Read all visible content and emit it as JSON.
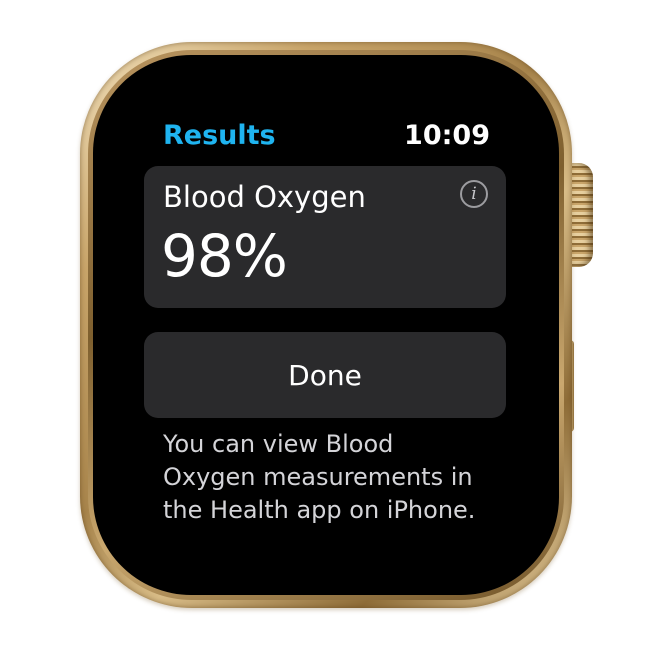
{
  "screen": {
    "header": {
      "title": "Results",
      "time": "10:09"
    },
    "measurement_card": {
      "label": "Blood Oxygen",
      "value": "98%",
      "info_icon": "info-circle-icon"
    },
    "done_button_label": "Done",
    "info_message": "You can view Blood Oxygen measurements in the Health app on iPhone."
  },
  "colors": {
    "accent": "#1fb4f0",
    "card_background": "#2a2a2c",
    "screen_background": "#000000",
    "case_gold": "#c9a56a"
  }
}
